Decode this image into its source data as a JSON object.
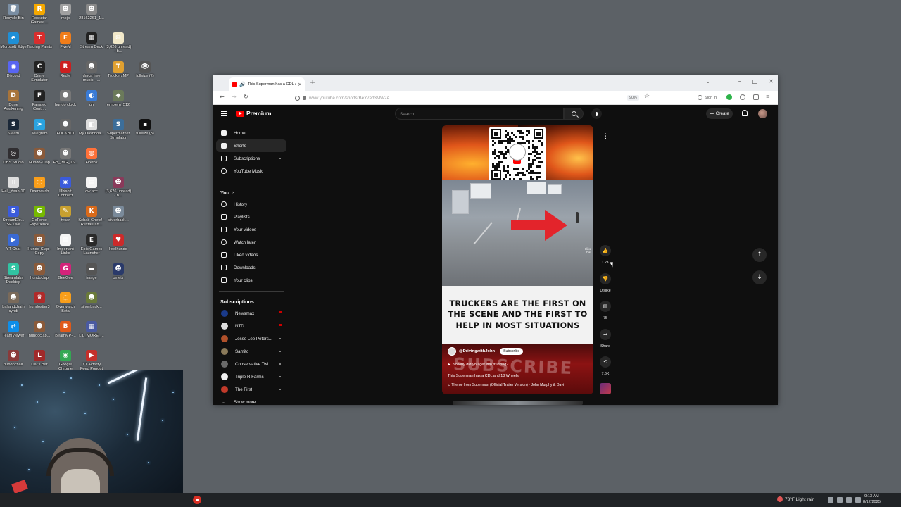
{
  "desktop": {
    "icons": [
      {
        "label": "Recycle Bin",
        "color": "#7a8ea3",
        "glyph": "🗑"
      },
      {
        "label": "Rockstar Games ...",
        "color": "#f5a800",
        "glyph": "R"
      },
      {
        "label": "mojo",
        "color": "#a0a0a0",
        "glyph": "☻"
      },
      {
        "label": "28162261_1...",
        "color": "#888888",
        "glyph": "☻"
      },
      {
        "label": "Microsoft Edge",
        "color": "#1f8fd6",
        "glyph": "e"
      },
      {
        "label": "Trading Paints",
        "color": "#d92d2d",
        "glyph": "T"
      },
      {
        "label": "FiveM",
        "color": "#f07d1a",
        "glyph": "F"
      },
      {
        "label": "Stream Deck",
        "color": "#222222",
        "glyph": "▦"
      },
      {
        "label": "(3,626 unread) - b...",
        "color": "#f1e8c8",
        "glyph": "✉"
      },
      {
        "label": "Discord",
        "color": "#5865f2",
        "glyph": "◉"
      },
      {
        "label": "Crime Simulator",
        "color": "#222222",
        "glyph": "C"
      },
      {
        "label": "RedM",
        "color": "#cc1f1f",
        "glyph": "R"
      },
      {
        "label": "dmca free music - ...",
        "color": "#666666",
        "glyph": "☻"
      },
      {
        "label": "TruckersMP",
        "color": "#e0a030",
        "glyph": "T"
      },
      {
        "label": "fullsize (2)",
        "color": "#555555",
        "glyph": "👁"
      },
      {
        "label": "Dune Awakening",
        "color": "#a8743a",
        "glyph": "D"
      },
      {
        "label": "Fanatec Contr...",
        "color": "#222222",
        "glyph": "F"
      },
      {
        "label": "hundo clock",
        "color": "#777777",
        "glyph": "☻"
      },
      {
        "label": "uh",
        "color": "#3a7bd5",
        "glyph": "◐"
      },
      {
        "label": "emblem_512",
        "color": "#6b7a5a",
        "glyph": "◆"
      },
      {
        "label": "Steam",
        "color": "#1b2838",
        "glyph": "S"
      },
      {
        "label": "Telegram",
        "color": "#2aa3e0",
        "glyph": "➤"
      },
      {
        "label": "FUCKBOI",
        "color": "#666666",
        "glyph": "☻"
      },
      {
        "label": "My Dashboa...",
        "color": "#dddddd",
        "glyph": "◧"
      },
      {
        "label": "Supermarket Simulator",
        "color": "#3c6e9a",
        "glyph": "S"
      },
      {
        "label": "fullsize (3)",
        "color": "#111111",
        "glyph": "▪"
      },
      {
        "label": "OBS Studio",
        "color": "#302e31",
        "glyph": "◎"
      },
      {
        "label": "Hundo-Clap",
        "color": "#8a5a3a",
        "glyph": "☻"
      },
      {
        "label": "FB_IMG_16...",
        "color": "#777777",
        "glyph": "☻"
      },
      {
        "label": "Firefox",
        "color": "#ff7139",
        "glyph": "◍"
      },
      {
        "label": "Hell_Yeah-10",
        "color": "#dddddd",
        "glyph": "▯"
      },
      {
        "label": "Overwatch",
        "color": "#f99e1a",
        "glyph": "◌"
      },
      {
        "label": "Ubisoft Connect",
        "color": "#3b5bdb",
        "glyph": "◉"
      },
      {
        "label": "ow acc",
        "color": "#f4f4f4",
        "glyph": "▤"
      },
      {
        "label": "(3,626 unread) - b...",
        "color": "#8a3a5a",
        "glyph": "☻"
      },
      {
        "label": "StreamEle... SE.Live",
        "color": "#3b5bdb",
        "glyph": "S"
      },
      {
        "label": "GeForce Experience",
        "color": "#76b900",
        "glyph": "G"
      },
      {
        "label": "tycar",
        "color": "#c8a030",
        "glyph": "✎"
      },
      {
        "label": "Kebab Chefs! - Restauran...",
        "color": "#d96a1a",
        "glyph": "K"
      },
      {
        "label": "silverback...",
        "color": "#7a8a9a",
        "glyph": "☻"
      },
      {
        "label": "YT Chat",
        "color": "#3a6ad4",
        "glyph": "▶"
      },
      {
        "label": "Hundo-Clap - Copy",
        "color": "#8a5a3a",
        "glyph": "☻"
      },
      {
        "label": "Important Links",
        "color": "#f4f4f4",
        "glyph": "▤"
      },
      {
        "label": "Epic Games Launcher",
        "color": "#2a2a2a",
        "glyph": "E"
      },
      {
        "label": "koolhundo",
        "color": "#cc2a2a",
        "glyph": "♥"
      },
      {
        "label": "Streamlabs Desktop",
        "color": "#31c3a2",
        "glyph": "S"
      },
      {
        "label": "hundoclap",
        "color": "#8a5a3a",
        "glyph": "☻"
      },
      {
        "label": "GeeGee",
        "color": "#d4237a",
        "glyph": "G"
      },
      {
        "label": "image",
        "color": "#555555",
        "glyph": "▬"
      },
      {
        "label": "ometv",
        "color": "#2a3a6a",
        "glyph": "☻"
      },
      {
        "label": "ballandchain cyndi",
        "color": "#7a6a5a",
        "glyph": "☻"
      },
      {
        "label": "hundostier3",
        "color": "#b02a2a",
        "glyph": "♛"
      },
      {
        "label": "Overwatch Beta",
        "color": "#f99e1a",
        "glyph": "◌"
      },
      {
        "label": "silverback...",
        "color": "#6a7a3a",
        "glyph": "☻"
      },
      {
        "label": "TeamViewer",
        "color": "#0e8ee9",
        "glyph": "⇄"
      },
      {
        "label": "hundoclap...",
        "color": "#8a5a3a",
        "glyph": "☻"
      },
      {
        "label": "BeamMP-...",
        "color": "#e05a1a",
        "glyph": "B"
      },
      {
        "label": "LIL_MORE_...",
        "color": "#4a5aa0",
        "glyph": "▦"
      },
      {
        "label": "hundochair",
        "color": "#8a3a3a",
        "glyph": "☻"
      },
      {
        "label": "Liar's Bar",
        "color": "#a02a2a",
        "glyph": "L"
      },
      {
        "label": "Google Chrome",
        "color": "#34a853",
        "glyph": "◉"
      },
      {
        "label": "YT Activity Feed Popout",
        "color": "#c4302b",
        "glyph": "▶"
      }
    ]
  },
  "taskbar": {
    "weather": "73°F  Light rain",
    "time": "9:13 AM",
    "date": "8/12/2025"
  },
  "browser": {
    "tab_title": "This Superman has a CDL a",
    "url": "www.youtube.com/shorts/BeY7ed3MW2A",
    "zoom": "90%",
    "sign_in": "Sign in"
  },
  "youtube": {
    "logo_text": "Premium",
    "search_placeholder": "Search",
    "create_label": "Create",
    "sidebar_main": [
      {
        "label": "Home",
        "name": "home"
      },
      {
        "label": "Shorts",
        "name": "shorts",
        "active": true
      },
      {
        "label": "Subscriptions",
        "name": "subscriptions"
      },
      {
        "label": "YouTube Music",
        "name": "youtube-music"
      }
    ],
    "you_label": "You",
    "sidebar_you": [
      {
        "label": "History",
        "name": "history"
      },
      {
        "label": "Playlists",
        "name": "playlists"
      },
      {
        "label": "Your videos",
        "name": "your-videos"
      },
      {
        "label": "Watch later",
        "name": "watch-later"
      },
      {
        "label": "Liked videos",
        "name": "liked-videos"
      },
      {
        "label": "Downloads",
        "name": "downloads"
      },
      {
        "label": "Your clips",
        "name": "your-clips"
      }
    ],
    "subscriptions_label": "Subscriptions",
    "subscriptions": [
      {
        "label": "Newsmax",
        "color": "#1a3a8a",
        "live": true
      },
      {
        "label": "NTD",
        "color": "#dddddd",
        "live": true
      },
      {
        "label": "Jesse Lee Peters...",
        "color": "#b0502a",
        "live": false
      },
      {
        "label": "Samito",
        "color": "#8a7a5a",
        "live": false
      },
      {
        "label": "Conservative Twi...",
        "color": "#6a6a6a",
        "live": false
      },
      {
        "label": "Triple R Farms",
        "color": "#f0f0f0",
        "live": false
      },
      {
        "label": "The First",
        "color": "#c23a2a",
        "live": false
      }
    ],
    "show_more": "Show more",
    "short": {
      "caption": "TRUCKERS ARE THE FIRST ON THE SCENE AND THE FIRST TO HELP IN MOST SITUATIONS",
      "overlay_like": "I like this",
      "banner": "SUBSCRIBE",
      "channel": "@DrivingwithJohn",
      "subscribe": "Subscribe",
      "line1": "So why did you get into trucking?",
      "title": "This Superman has a CDL and 18 Wheels",
      "music": "Theme from Superman (Official Trailer Version) · John Murphy & Davi"
    },
    "actions": {
      "likes": "1.2K",
      "dislike": "Dislike",
      "comments": "75",
      "share": "Share",
      "remix_count": "7.6K"
    }
  }
}
